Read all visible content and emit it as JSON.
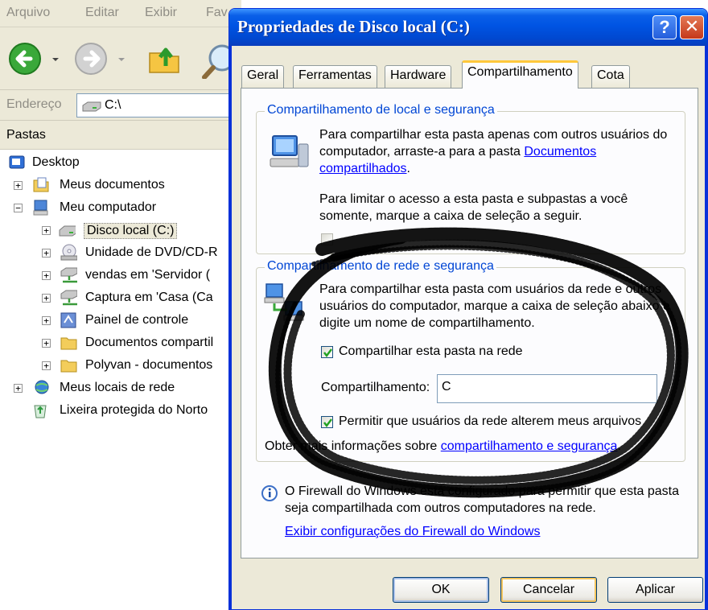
{
  "explorer": {
    "menu": [
      "Arquivo",
      "Editar",
      "Exibir",
      "Fav"
    ],
    "address_label": "Endereço",
    "address_value": "C:\\",
    "pane_title": "Pastas",
    "tree": [
      {
        "label": "Desktop",
        "icon": "desktop-icon"
      },
      {
        "label": "Meus documentos",
        "icon": "folder-documents-icon"
      },
      {
        "label": "Meu computador",
        "icon": "computer-icon"
      },
      {
        "label": "Disco local (C:)",
        "icon": "hard-drive-icon"
      },
      {
        "label": "Unidade de DVD/CD-R",
        "icon": "dvd-drive-icon"
      },
      {
        "label": "vendas em 'Servidor (",
        "icon": "network-drive-icon"
      },
      {
        "label": "Captura em 'Casa (Ca",
        "icon": "network-drive-icon"
      },
      {
        "label": "Painel de controle",
        "icon": "control-panel-icon"
      },
      {
        "label": "Documentos compartil",
        "icon": "folder-icon"
      },
      {
        "label": "Polyvan - documentos",
        "icon": "folder-icon"
      },
      {
        "label": "Meus locais de rede",
        "icon": "network-places-icon"
      },
      {
        "label": "Lixeira protegida do Norto",
        "icon": "recycle-bin-icon"
      }
    ]
  },
  "dialog": {
    "title": "Propriedades de Disco local (C:)",
    "help_glyph": "?",
    "close_glyph": "✕",
    "tabs": [
      "Geral",
      "Ferramentas",
      "Hardware",
      "Compartilhamento",
      "Cota"
    ],
    "local": {
      "legend": "Compartilhamento de local e segurança",
      "text1": "Para compartilhar esta pasta apenas com outros usuários do computador, arraste-a para a pasta",
      "link1": "Documentos compartilhados",
      "text1_end": ".",
      "text2": "Para limitar o acesso a esta pasta e subpastas a você somente, marque a caixa de seleção a seguir."
    },
    "network": {
      "legend": "Compartilhamento de rede e segurança",
      "text": "Para compartilhar esta pasta com usuários da rede e outros usuários do computador, marque a caixa de seleção abaixo e digite um nome de compartilhamento.",
      "share_checkbox_label": "Compartilhar esta pasta na rede",
      "share_name_label": "Compartilhamento:",
      "share_name_value": "C",
      "allow_checkbox_label": "Permitir que usuários da rede alterem meus arquivos",
      "more_info_prefix": "Obter mais informações sobre",
      "more_info_link": "compartilhamento e segurança",
      "more_info_suffix": "."
    },
    "firewall": {
      "text": "O Firewall do Windows está configurado para permitir que esta pasta seja compartilhada com outros computadores na rede.",
      "link": "Exibir configurações do Firewall do Windows"
    },
    "buttons": {
      "ok": "OK",
      "cancel": "Cancelar",
      "apply": "Aplicar"
    }
  }
}
